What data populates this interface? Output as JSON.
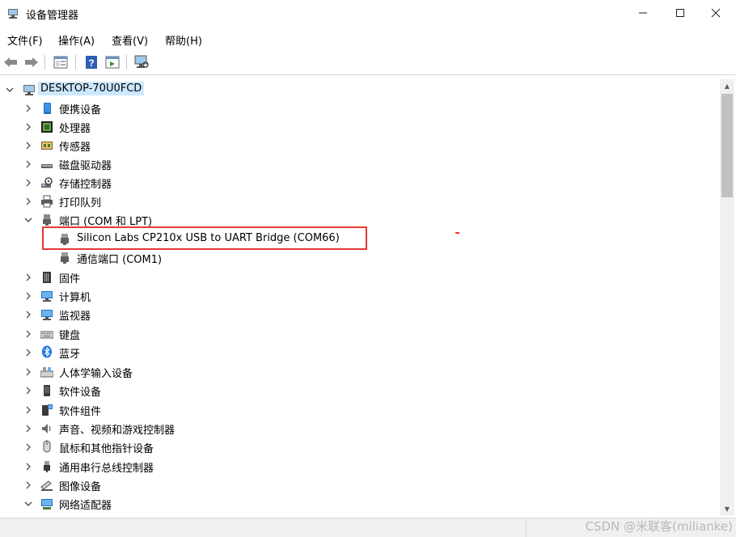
{
  "window": {
    "title": "设备管理器"
  },
  "menu": [
    "文件(F)",
    "操作(A)",
    "查看(V)",
    "帮助(H)"
  ],
  "tree": {
    "root": "DESKTOP-70U0FCD",
    "items": [
      {
        "label": "便携设备",
        "icon": "portable-device-icon",
        "expanded": false
      },
      {
        "label": "处理器",
        "icon": "processor-icon",
        "expanded": false
      },
      {
        "label": "传感器",
        "icon": "sensor-icon",
        "expanded": false
      },
      {
        "label": "磁盘驱动器",
        "icon": "disk-drive-icon",
        "expanded": false
      },
      {
        "label": "存储控制器",
        "icon": "storage-controller-icon",
        "expanded": false
      },
      {
        "label": "打印队列",
        "icon": "printer-icon",
        "expanded": false
      },
      {
        "label": "端口 (COM 和 LPT)",
        "icon": "port-icon",
        "expanded": true,
        "children": [
          {
            "label": "Silicon Labs CP210x USB to UART Bridge (COM66)",
            "icon": "port-connector-icon"
          },
          {
            "label": "通信端口 (COM1)",
            "icon": "port-connector-icon"
          }
        ]
      },
      {
        "label": "固件",
        "icon": "firmware-icon",
        "expanded": false
      },
      {
        "label": "计算机",
        "icon": "computer-icon",
        "expanded": false
      },
      {
        "label": "监视器",
        "icon": "monitor-icon",
        "expanded": false
      },
      {
        "label": "键盘",
        "icon": "keyboard-icon",
        "expanded": false
      },
      {
        "label": "蓝牙",
        "icon": "bluetooth-icon",
        "expanded": false
      },
      {
        "label": "人体学输入设备",
        "icon": "hid-icon",
        "expanded": false
      },
      {
        "label": "软件设备",
        "icon": "software-device-icon",
        "expanded": false
      },
      {
        "label": "软件组件",
        "icon": "software-component-icon",
        "expanded": false
      },
      {
        "label": "声音、视频和游戏控制器",
        "icon": "audio-icon",
        "expanded": false
      },
      {
        "label": "鼠标和其他指针设备",
        "icon": "mouse-icon",
        "expanded": false
      },
      {
        "label": "通用串行总线控制器",
        "icon": "usb-icon",
        "expanded": false
      },
      {
        "label": "图像设备",
        "icon": "camera-icon",
        "expanded": false
      },
      {
        "label": "网络适配器",
        "icon": "network-adapter-icon",
        "expanded": true
      }
    ]
  },
  "watermark": "CSDN @米联客(milianke)",
  "colors": {
    "selection": "#cce8ff",
    "highlight_box": "#e53935"
  }
}
